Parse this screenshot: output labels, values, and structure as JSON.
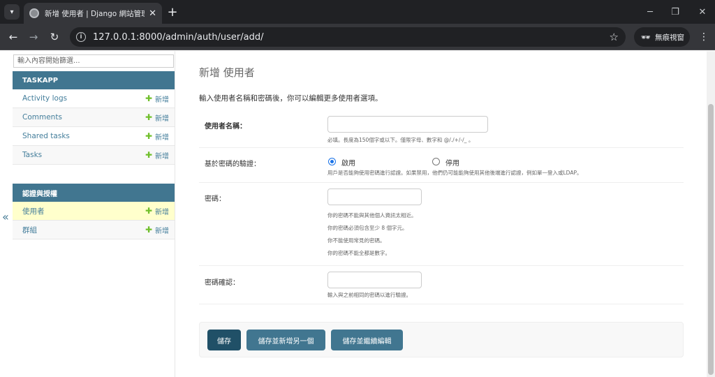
{
  "browser": {
    "tab_title": "新增 使用者 | Django 網站管理",
    "url": "127.0.0.1:8000/admin/auth/user/add/",
    "profile_label": "無痕視窗",
    "icons": {
      "tab_search": "chevron-down-icon",
      "new_tab": "plus-icon",
      "back": "arrow-left-icon",
      "forward": "arrow-right-icon",
      "reload": "reload-icon",
      "site_info": "info-icon",
      "bookmark": "star-icon",
      "incognito": "incognito-icon",
      "menu": "kebab-menu-icon"
    }
  },
  "sidebar": {
    "filter_placeholder": "輸入內容開始篩選...",
    "collapse_glyph": "«",
    "add_label": "新增",
    "modules": [
      {
        "caption": "TASKAPP",
        "models": [
          {
            "name": "Activity logs"
          },
          {
            "name": "Comments"
          },
          {
            "name": "Shared tasks"
          },
          {
            "name": "Tasks"
          }
        ]
      },
      {
        "caption": "認證與授權",
        "models": [
          {
            "name": "使用者",
            "current": true
          },
          {
            "name": "群組"
          }
        ]
      }
    ]
  },
  "content": {
    "title": "新增 使用者",
    "intro": "輸入使用者名稱和密碼後，你可以編輯更多使用者選項。",
    "fields": {
      "username": {
        "label": "使用者名稱：",
        "help": "必填。長度為150個字或以下。僅限字母、數字和 @/./+/-/_ 。",
        "value": ""
      },
      "usable_password": {
        "label": "基於密碼的驗證：",
        "options": [
          "啟用",
          "停用"
        ],
        "selected": "啟用",
        "help": "用戶是否能夠使用密碼進行認證。如果禁用，他們仍可能能夠使用其他後端進行認證，例如單一登入或LDAP。"
      },
      "password1": {
        "label": "密碼：",
        "value": "",
        "help": [
          "你的密碼不能與其他個人資訊太相近。",
          "你的密碼必須包含至少 8 個字元。",
          "你不能使用常見的密碼。",
          "你的密碼不能全都是數字。"
        ]
      },
      "password2": {
        "label": "密碼確認：",
        "value": "",
        "help": "輸入與之前相同的密碼以進行驗證。"
      }
    },
    "buttons": {
      "save": "儲存",
      "save_add_another": "儲存並新增另一個",
      "save_continue": "儲存並繼續編輯"
    }
  },
  "colors": {
    "module_header": "#417690",
    "link": "#447e9b",
    "current_row": "#ffffcc",
    "add_plus": "#70bf2b",
    "primary_button": "#205067",
    "secondary_button": "#417690"
  }
}
